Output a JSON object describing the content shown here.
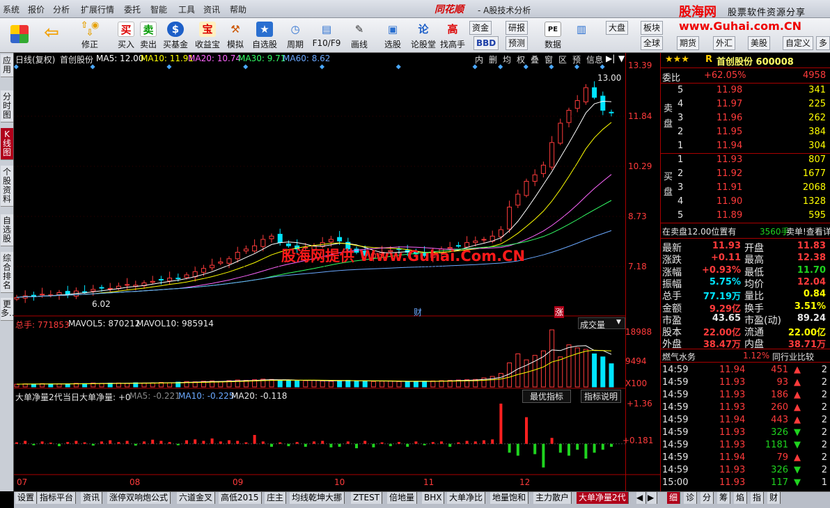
{
  "menu": [
    "系统",
    "报价",
    "分析",
    "扩展行情",
    "委托",
    "智能",
    "工具",
    "资讯",
    "帮助"
  ],
  "app": {
    "brand": "同花顺",
    "subtitle": "- A股技术分析"
  },
  "watermark": {
    "logo": "股海网",
    "text": "股票软件资源分享",
    "url": "www.Guhai.com.CN",
    "center": "股海网提供 Www.Guhai.Com.CN"
  },
  "toolbar": [
    {
      "label": "",
      "icon": "layout-icon"
    },
    {
      "label": "",
      "icon": "back-arrow-icon"
    },
    {
      "label": "修正",
      "icon": "up-down-arrows-icon"
    },
    {
      "label": "买入",
      "glyph": "买"
    },
    {
      "label": "卖出",
      "glyph": "卖"
    },
    {
      "label": "买基金",
      "glyph": "$"
    },
    {
      "label": "收益宝",
      "glyph": "宝"
    },
    {
      "label": "模拟",
      "glyph": "⚒"
    },
    {
      "label": "自选股",
      "glyph": "★"
    },
    {
      "label": "周期",
      "glyph": "◷"
    },
    {
      "label": "F10/F9",
      "glyph": "▤"
    },
    {
      "label": "画线",
      "glyph": "✎"
    },
    {
      "label": "选股",
      "glyph": "▣"
    },
    {
      "label": "论股堂",
      "glyph": "论"
    },
    {
      "label": "找高手",
      "glyph": "高"
    }
  ],
  "toolbar_small": [
    "资金",
    "研报",
    "BBD",
    "预测",
    "数据",
    "大盘",
    "板块",
    "全球",
    "期货",
    "外汇",
    "美股",
    "自定义",
    "多"
  ],
  "lefttabs": [
    "应用",
    "分时图",
    "K线图",
    "个股资料",
    "自选股",
    "综合排名",
    "更多..."
  ],
  "main_chart": {
    "legend_title": "日线(复权)",
    "stock": "首创股份",
    "ma": [
      {
        "label": "MA5: 12.00",
        "color": "#ffffff"
      },
      {
        "label": "MA10: 11.91",
        "color": "#ffff00"
      },
      {
        "label": "MA20: 10.74",
        "color": "#ff66ff"
      },
      {
        "label": "MA30: 9.71",
        "color": "#33ff66"
      },
      {
        "label": "MA60: 8.62",
        "color": "#6aa8ff"
      }
    ],
    "tools": [
      "内",
      "删",
      "均",
      "权",
      "叠",
      "窗",
      "区",
      "预",
      "信息",
      "▶|",
      "▼"
    ],
    "yticks": [
      "13.39",
      "11.84",
      "10.29",
      "8.73",
      "7.18"
    ],
    "high_label": "13.00",
    "low_label": "6.02",
    "markers": [
      "财",
      "涨"
    ]
  },
  "volume_chart": {
    "total": "总手: 771853",
    "mavol5": "MAVOL5: 870212",
    "mavol10": "MAVOL10: 985914",
    "selector": "成交量",
    "yticks": [
      "18988",
      "9494",
      "X100"
    ]
  },
  "indicator_chart": {
    "title": "大单净量2代",
    "today": "当日大单净量: +0",
    "ma5": "MA5: -0.221",
    "ma10": "MA10: -0.225",
    "ma20": "MA20: -0.118",
    "btn1": "最优指标",
    "btn2": "指标说明",
    "yticks": [
      "+1.36",
      "+0.181"
    ]
  },
  "xaxis": [
    "07",
    "08",
    "09",
    "10",
    "11",
    "12"
  ],
  "bottomtabs": [
    "设置",
    "指标平台",
    "资讯",
    "涨停双响炮公式",
    "六道金叉",
    "高低2015",
    "庄主",
    "均线乾坤大挪",
    "ZTEST",
    "倍地量",
    "BHX",
    "大单净比",
    "地量饱和",
    "主力散户",
    "大单净量2代"
  ],
  "bottom_right_tabs": [
    "细",
    "诊",
    "分",
    "筹",
    "焰",
    "指",
    "财"
  ],
  "quote": {
    "stars": "★★★",
    "r_label": "R",
    "name": "首创股份 600008",
    "weibi_label": "委比",
    "weibi": "+62.05%",
    "weicha": "4958",
    "sell_label": "卖盘",
    "buy_label": "买盘",
    "sell": [
      {
        "lv": "5",
        "p": "11.98",
        "v": "341"
      },
      {
        "lv": "4",
        "p": "11.97",
        "v": "225"
      },
      {
        "lv": "3",
        "p": "11.96",
        "v": "262"
      },
      {
        "lv": "2",
        "p": "11.95",
        "v": "384"
      },
      {
        "lv": "1",
        "p": "11.94",
        "v": "304"
      }
    ],
    "buy": [
      {
        "lv": "1",
        "p": "11.93",
        "v": "807"
      },
      {
        "lv": "2",
        "p": "11.92",
        "v": "1677"
      },
      {
        "lv": "3",
        "p": "11.91",
        "v": "2068"
      },
      {
        "lv": "4",
        "p": "11.90",
        "v": "1328"
      },
      {
        "lv": "5",
        "p": "11.89",
        "v": "595"
      }
    ],
    "notice1": "在卖盘12.00位置有",
    "notice2": "3560手",
    "notice3": "卖单!查看详细",
    "stats": [
      [
        "最新",
        "11.93",
        "开盘",
        "11.83"
      ],
      [
        "涨跌",
        "+0.11",
        "最高",
        "12.38"
      ],
      [
        "涨幅",
        "+0.93%",
        "最低",
        "11.70"
      ],
      [
        "振幅",
        "5.75%",
        "均价",
        "12.04"
      ],
      [
        "总手",
        "77.19万",
        "量比",
        "0.84"
      ],
      [
        "金额",
        "9.29亿",
        "换手",
        "3.51%"
      ],
      [
        "市盈",
        "43.65",
        "市盈(动)",
        "89.24"
      ],
      [
        "股本",
        "22.00亿",
        "流通",
        "22.00亿"
      ],
      [
        "外盘",
        "38.47万",
        "内盘",
        "38.71万"
      ]
    ],
    "industry": "燃气水务",
    "industry_pct": "1.12%",
    "industry_btn": "同行业比较",
    "ticks": [
      {
        "t": "14:59",
        "p": "11.94",
        "v": "451",
        "d": "up",
        "n": "2"
      },
      {
        "t": "14:59",
        "p": "11.93",
        "v": "93",
        "d": "up",
        "n": "2"
      },
      {
        "t": "14:59",
        "p": "11.93",
        "v": "186",
        "d": "up",
        "n": "2"
      },
      {
        "t": "14:59",
        "p": "11.93",
        "v": "260",
        "d": "up",
        "n": "2"
      },
      {
        "t": "14:59",
        "p": "11.94",
        "v": "443",
        "d": "up",
        "n": "2"
      },
      {
        "t": "14:59",
        "p": "11.93",
        "v": "326",
        "d": "down",
        "n": "2"
      },
      {
        "t": "14:59",
        "p": "11.93",
        "v": "1181",
        "d": "down",
        "n": "2"
      },
      {
        "t": "14:59",
        "p": "11.94",
        "v": "79",
        "d": "up",
        "n": "2"
      },
      {
        "t": "14:59",
        "p": "11.93",
        "v": "326",
        "d": "down",
        "n": "2"
      },
      {
        "t": "15:00",
        "p": "11.93",
        "v": "117",
        "d": "down",
        "n": "1"
      }
    ]
  },
  "chart_data": {
    "type": "candlestick",
    "price_range": [
      5.8,
      13.39
    ],
    "closes": [
      6.2,
      6.25,
      6.22,
      6.3,
      6.28,
      6.35,
      6.3,
      6.4,
      6.38,
      6.45,
      6.5,
      6.48,
      6.55,
      6.6,
      6.58,
      6.65,
      6.7,
      6.75,
      6.8,
      6.78,
      6.9,
      7.0,
      7.1,
      7.2,
      7.3,
      7.4,
      7.6,
      7.7,
      7.8,
      8.0,
      8.1,
      7.9,
      7.8,
      7.7,
      7.75,
      7.8,
      7.9,
      8.0,
      7.95,
      7.7,
      7.6,
      7.5,
      7.55,
      7.6,
      7.65,
      7.7,
      7.6,
      7.55,
      7.5,
      7.6,
      7.7,
      7.75,
      7.8,
      7.9,
      7.95,
      8.0,
      8.1,
      8.3,
      9.0,
      9.4,
      9.8,
      10.0,
      10.3,
      11.0,
      11.6,
      12.0,
      12.3,
      12.7,
      12.4,
      12.0,
      11.93
    ],
    "volume_range": [
      0,
      18988
    ],
    "volumes": [
      900,
      1000,
      950,
      1100,
      1000,
      1050,
      1000,
      1200,
      1100,
      1300,
      1200,
      1250,
      1300,
      1200,
      1400,
      1300,
      1350,
      1500,
      1400,
      1600,
      1800,
      1700,
      1900,
      2000,
      1800,
      2100,
      2300,
      2200,
      2400,
      2600,
      2500,
      2200,
      2100,
      2000,
      2100,
      2200,
      2000,
      1900,
      2100,
      2200,
      2000,
      1900,
      1800,
      1900,
      2000,
      1800,
      1700,
      1800,
      1900,
      2000,
      2100,
      2200,
      2300,
      2400,
      2500,
      3000,
      3500,
      4500,
      8000,
      11000,
      9000,
      10500,
      12000,
      18988,
      10000,
      14000,
      13000,
      12500,
      11000,
      10000,
      7718
    ],
    "indicator_range": [
      -0.9,
      1.36
    ],
    "indicator": [
      0.05,
      0.1,
      -0.05,
      0.08,
      0.04,
      -0.08,
      0.06,
      0.1,
      0.05,
      -0.06,
      0.08,
      0.12,
      0.06,
      0.1,
      -0.06,
      0.08,
      0.14,
      0.1,
      0.06,
      -0.05,
      0.12,
      0.15,
      0.1,
      0.18,
      0.08,
      0.12,
      0.1,
      0.05,
      0.3,
      0.08,
      -0.1,
      0.05,
      -0.08,
      0.06,
      -0.1,
      0.08,
      0.1,
      -0.12,
      -0.1,
      0.08,
      -0.15,
      0.1,
      -0.12,
      0.05,
      -0.08,
      0.06,
      -0.1,
      0.08,
      -0.05,
      0.06,
      0.08,
      -0.1,
      0.05,
      0.1,
      0.08,
      0.12,
      0.15,
      1.36,
      -0.3,
      -0.4,
      0.9,
      -0.35,
      -0.8,
      0.2,
      -0.3,
      -0.4,
      -0.2,
      -0.5,
      -0.3,
      -0.2,
      -0.1
    ]
  }
}
